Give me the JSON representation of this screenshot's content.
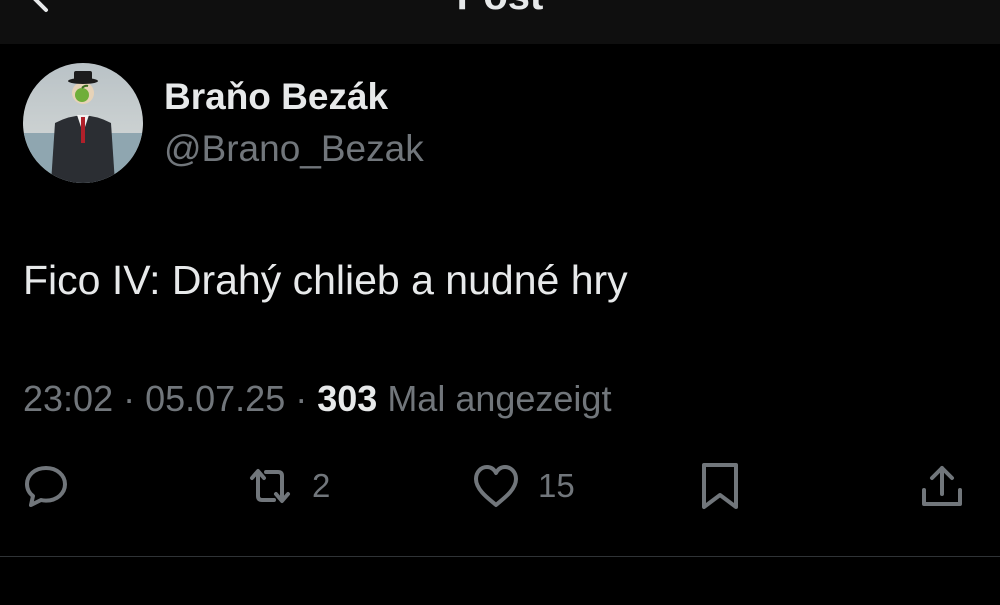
{
  "header": {
    "title": "Post",
    "back_icon": "arrow-left-icon"
  },
  "author": {
    "name": "Braňo Bezák",
    "handle": "@Brano_Bezak",
    "avatar_icon": "avatar-image"
  },
  "post": {
    "text": "Fico IV: Drahý chlieb a nudné hry"
  },
  "meta": {
    "time": "23:02",
    "sep1": " · ",
    "date": "05.07.25",
    "sep2": " · ",
    "views_count": "303",
    "views_label": " Mal angezeigt"
  },
  "actions": {
    "reply": {
      "icon": "reply-icon",
      "count": ""
    },
    "repost": {
      "icon": "repost-icon",
      "count": "2"
    },
    "like": {
      "icon": "heart-icon",
      "count": "15"
    },
    "bookmark": {
      "icon": "bookmark-icon"
    },
    "share": {
      "icon": "share-icon"
    }
  },
  "colors": {
    "background": "#000000",
    "text": "#e7e9ea",
    "muted": "#71767b"
  }
}
